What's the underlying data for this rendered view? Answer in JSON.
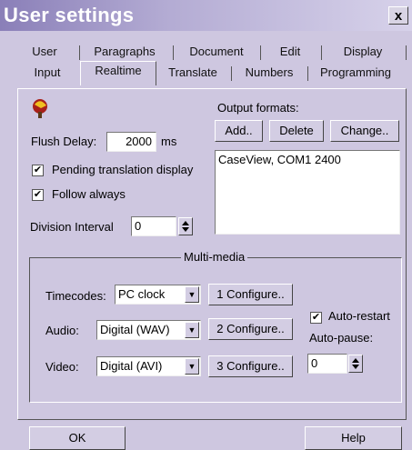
{
  "window": {
    "title": "User settings",
    "close_label": "x"
  },
  "tabs": {
    "row1": [
      "User",
      "Paragraphs",
      "Document",
      "Edit",
      "Display"
    ],
    "row2": [
      "Input",
      "Realtime",
      "Translate",
      "Numbers",
      "Programming"
    ],
    "active": "Realtime"
  },
  "realtime": {
    "flush_delay_label": "Flush Delay:",
    "flush_delay_value": "2000",
    "flush_delay_unit": "ms",
    "pending_label": "Pending translation display",
    "pending_checked": true,
    "follow_label": "Follow always",
    "follow_checked": true,
    "division_label": "Division Interval",
    "division_value": "0"
  },
  "output": {
    "label": "Output formats:",
    "add_label": "Add..",
    "delete_label": "Delete",
    "change_label": "Change..",
    "items": [
      "CaseView, COM1 2400"
    ]
  },
  "multimedia": {
    "title": "Multi-media",
    "timecodes_label": "Timecodes:",
    "timecodes_value": "PC clock",
    "audio_label": "Audio:",
    "audio_value": "Digital (WAV)",
    "video_label": "Video:",
    "video_value": "Digital (AVI)",
    "configure1_label": "1 Configure..",
    "configure2_label": "2 Configure..",
    "configure3_label": "3 Configure..",
    "auto_restart_label": "Auto-restart",
    "auto_restart_checked": true,
    "auto_pause_label": "Auto-pause:",
    "auto_pause_value": "0"
  },
  "footer": {
    "ok_label": "OK",
    "help_label": "Help"
  },
  "colors": {
    "dialog_bg": "#cec7e0",
    "title_gradient_start": "#8a7fb8"
  }
}
